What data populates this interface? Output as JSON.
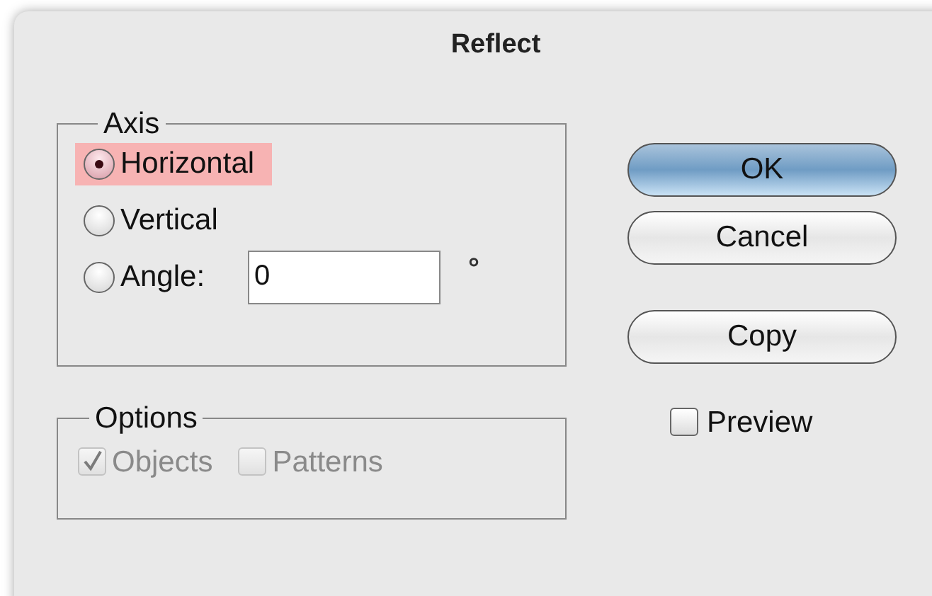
{
  "window": {
    "title": "Reflect"
  },
  "axis": {
    "title": "Axis",
    "options": [
      {
        "label": "Horizontal",
        "selected": true,
        "highlighted": true,
        "kind": "radio"
      },
      {
        "label": "Vertical",
        "selected": false,
        "highlighted": false,
        "kind": "radio"
      },
      {
        "label": "Angle:",
        "selected": false,
        "highlighted": false,
        "kind": "angle",
        "value": "0",
        "unit": "°"
      }
    ]
  },
  "options": {
    "title": "Options",
    "items": [
      {
        "label": "Objects",
        "checked": true,
        "disabled": true
      },
      {
        "label": "Patterns",
        "checked": false,
        "disabled": true
      }
    ]
  },
  "buttons": [
    {
      "label": "OK",
      "default": true
    },
    {
      "label": "Cancel",
      "default": false
    },
    {
      "label": "Copy",
      "default": false
    }
  ],
  "preview": {
    "label": "Preview",
    "checked": false
  }
}
